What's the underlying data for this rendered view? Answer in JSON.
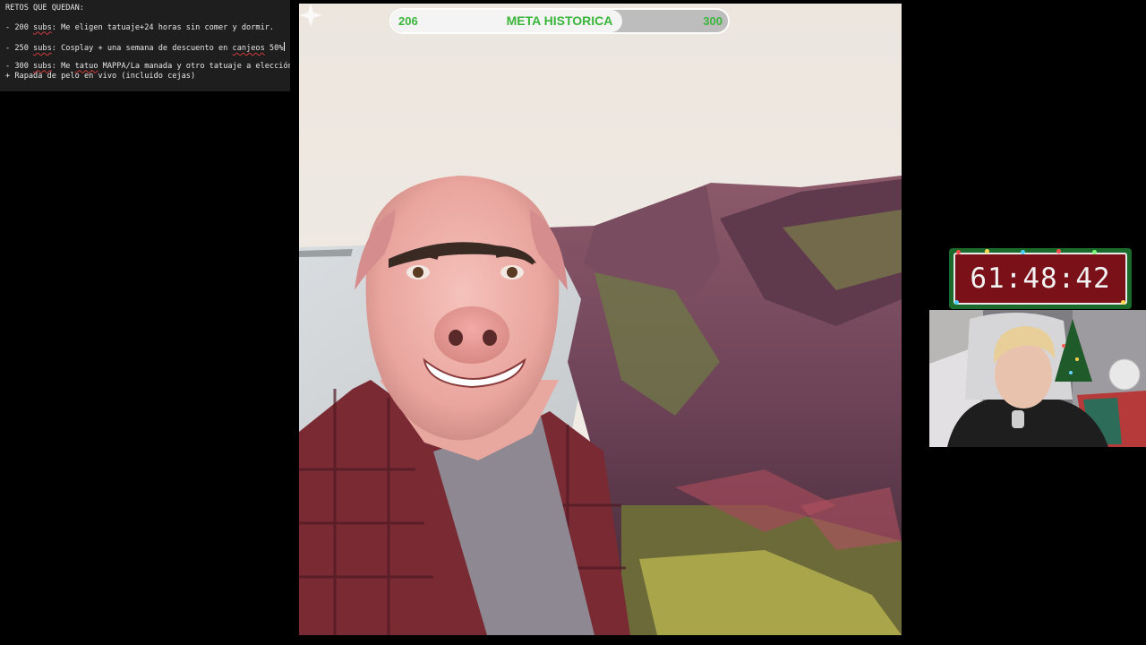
{
  "notes": {
    "heading": "RETOS QUE QUEDAN:",
    "items": [
      {
        "prefix": "- 200 ",
        "subs": "subs",
        "text": ": Me eligen tatuaje+24 horas sin comer y dormir."
      },
      {
        "prefix": "- 250 ",
        "subs": "subs",
        "text": ": Cosplay + una semana de descuento en ",
        "tail_word": "canjeos",
        "tail_rest": " 50%"
      },
      {
        "prefix": "- 300 ",
        "subs": "subs",
        "text": ": Me ",
        "word2": "tatuo",
        "text2": " MAPPA/La manada y otro tatuaje a elección"
      }
    ],
    "extra_line": "+ Rapada de pelo en vivo (incluido cejas)"
  },
  "goal": {
    "current": "206",
    "title": "META HISTORICA",
    "target": "300",
    "progress": 0.685,
    "text_color": "#3ab53a"
  },
  "timer": {
    "value": "61:48:42"
  },
  "scene": {
    "subject": "pig-face-selfie",
    "icon": "sparkle-icon"
  },
  "webcam": {
    "subject": "streamer-webcam"
  }
}
